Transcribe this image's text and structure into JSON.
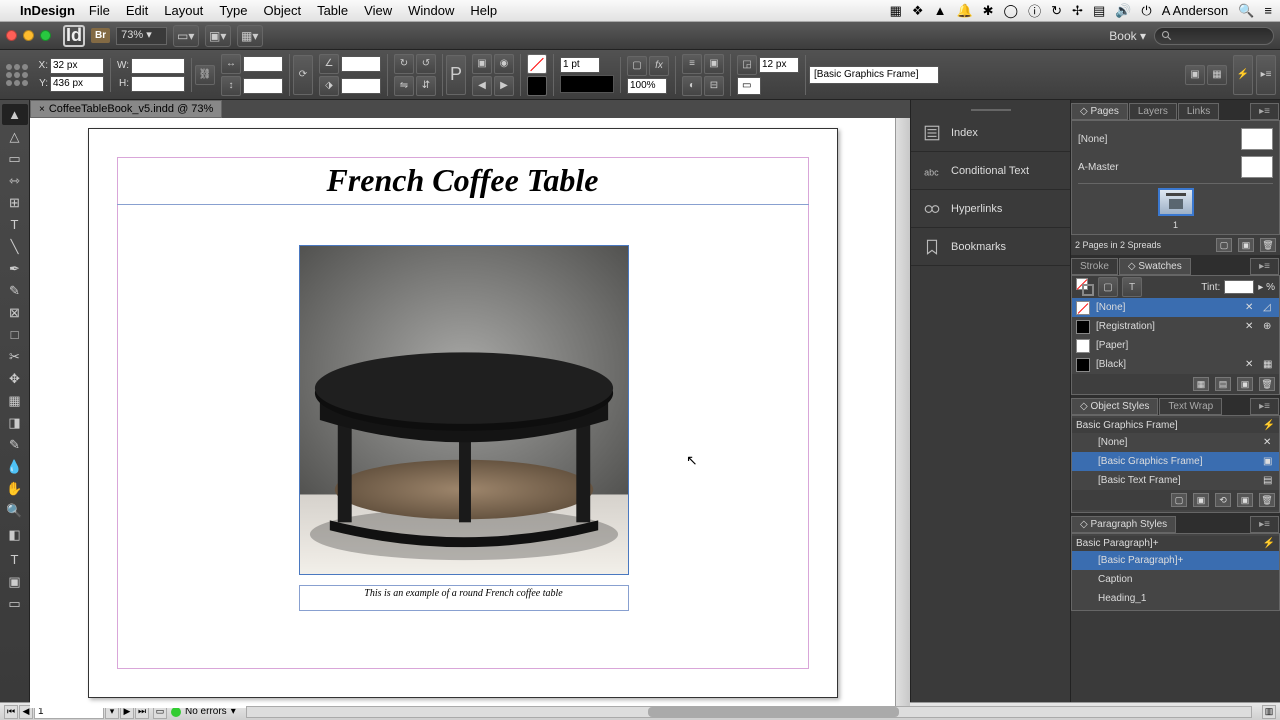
{
  "mac": {
    "app": "InDesign",
    "menus": [
      "File",
      "Edit",
      "Layout",
      "Type",
      "Object",
      "Table",
      "View",
      "Window",
      "Help"
    ],
    "user": "A Anderson"
  },
  "toolbar": {
    "zoom": "73%",
    "workspace": "Book"
  },
  "ctrl": {
    "x_label": "X:",
    "y_label": "Y:",
    "w_label": "W:",
    "h_label": "H:",
    "x": "32 px",
    "y": "436 px",
    "w": "",
    "h": "",
    "stroke_wt": "1 pt",
    "gap": "12 px",
    "opacity": "100%",
    "style_dropdown": "[Basic Graphics Frame]"
  },
  "doc": {
    "tab_title": "CoffeeTableBook_v5.indd @ 73%",
    "title": "French Coffee Table",
    "caption": "This is an example of a round French coffee table"
  },
  "collapsed": {
    "index": "Index",
    "conditional": "Conditional Text",
    "hyperlinks": "Hyperlinks",
    "bookmarks": "Bookmarks"
  },
  "panels": {
    "pages": {
      "tab": "Pages",
      "layers_tab": "Layers",
      "links_tab": "Links",
      "none": "[None]",
      "master": "A-Master",
      "page_num": "1",
      "footer": "2 Pages in 2 Spreads"
    },
    "swatches": {
      "stroke_tab": "Stroke",
      "swatches_tab": "Swatches",
      "tint_label": "Tint:",
      "tint_suffix": "%",
      "none": "[None]",
      "registration": "[Registration]",
      "paper": "[Paper]",
      "black": "[Black]"
    },
    "object": {
      "obj_tab": "Object Styles",
      "wrap_tab": "Text Wrap",
      "header": "Basic Graphics Frame]",
      "none": "[None]",
      "bgf": "[Basic Graphics Frame]",
      "btf": "[Basic Text Frame]"
    },
    "para": {
      "tab": "Paragraph Styles",
      "header": "Basic Paragraph]+",
      "bp": "[Basic Paragraph]+",
      "caption": "Caption",
      "h1": "Heading_1"
    }
  },
  "status": {
    "page": "1",
    "errors": "No errors"
  }
}
